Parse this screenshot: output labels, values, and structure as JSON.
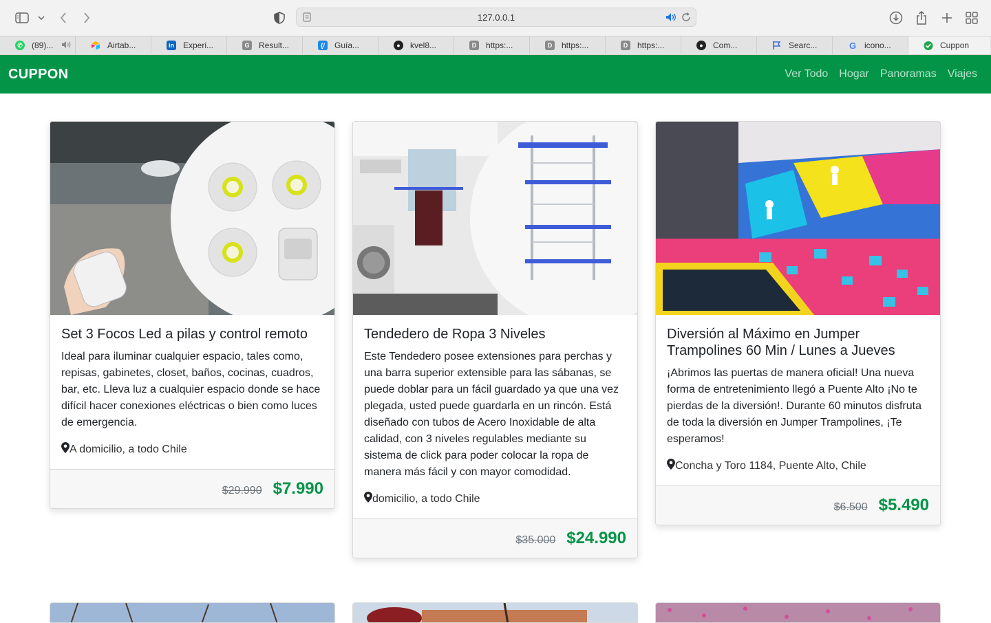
{
  "browser": {
    "url": "127.0.0.1",
    "tabs": [
      {
        "label": "(89)...",
        "icon": "whatsapp-icon",
        "color": "#25d366"
      },
      {
        "label": "Airtab...",
        "icon": "airtable-icon",
        "color": "#fcb400"
      },
      {
        "label": "Experi...",
        "icon": "linkedin-icon",
        "color": "#0a66c2"
      },
      {
        "label": "Result...",
        "icon": "g-icon",
        "color": "#888888"
      },
      {
        "label": "Guía...",
        "icon": "code-icon",
        "color": "#1e88e5"
      },
      {
        "label": "kvel8...",
        "icon": "github-icon",
        "color": "#222222"
      },
      {
        "label": "https:...",
        "icon": "d-icon",
        "color": "#888888"
      },
      {
        "label": "https:...",
        "icon": "d-icon",
        "color": "#888888"
      },
      {
        "label": "https:...",
        "icon": "d-icon",
        "color": "#888888"
      },
      {
        "label": "Com...",
        "icon": "github-icon",
        "color": "#222222"
      },
      {
        "label": "Searc...",
        "icon": "flag-icon",
        "color": "#3b6fd4"
      },
      {
        "label": "icono...",
        "icon": "google-icon",
        "color": "#4285f4"
      },
      {
        "label": "Cuppon",
        "icon": "cuppon-icon",
        "color": "#1fa84f"
      }
    ]
  },
  "navbar": {
    "brand": "CUPPON",
    "links": [
      "Ver Todo",
      "Hogar",
      "Panoramas",
      "Viajes"
    ]
  },
  "cards": [
    {
      "title": "Set 3 Focos Led a pilas y control remoto",
      "text": "Ideal para iluminar cualquier espacio, tales como, repisas, gabinetes, closet, baños, cocinas, cuadros, bar, etc. Lleva luz a cualquier espacio donde se hace difícil hacer conexiones eléctricas o bien como luces de emergencia.",
      "location": "A domicilio, a todo Chile",
      "old_price": "$29.990",
      "new_price": "$7.990"
    },
    {
      "title": "Tendedero de Ropa 3 Niveles",
      "text": "Este Tendedero posee extensiones para perchas y una barra superior extensible para las sábanas, se puede doblar para un fácil guardado ya que una vez plegada, usted puede guardarla en un rincón. Está diseñado con tubos de Acero Inoxidable de alta calidad, con 3 niveles regulables mediante su sistema de click para poder colocar la ropa de manera más fácil y con mayor comodidad.",
      "location": " domicilio, a todo Chile",
      "old_price": "$35.000",
      "new_price": "$24.990"
    },
    {
      "title": "Diversión al Máximo en Jumper Trampolines 60 Min / Lunes a Jueves",
      "text": "¡Abrimos las puertas de manera oficial! Una nueva forma de entretenimiento llegó a Puente Alto ¡No te pierdas de la diversión!. Durante 60 minutos disfruta de toda la diversión en Jumper Trampolines, ¡Te esperamos!",
      "location": " Concha y Toro 1184, Puente Alto, Chile",
      "old_price": "$6.500",
      "new_price": "$5.490"
    }
  ],
  "colors": {
    "brand_green": "#039447"
  }
}
